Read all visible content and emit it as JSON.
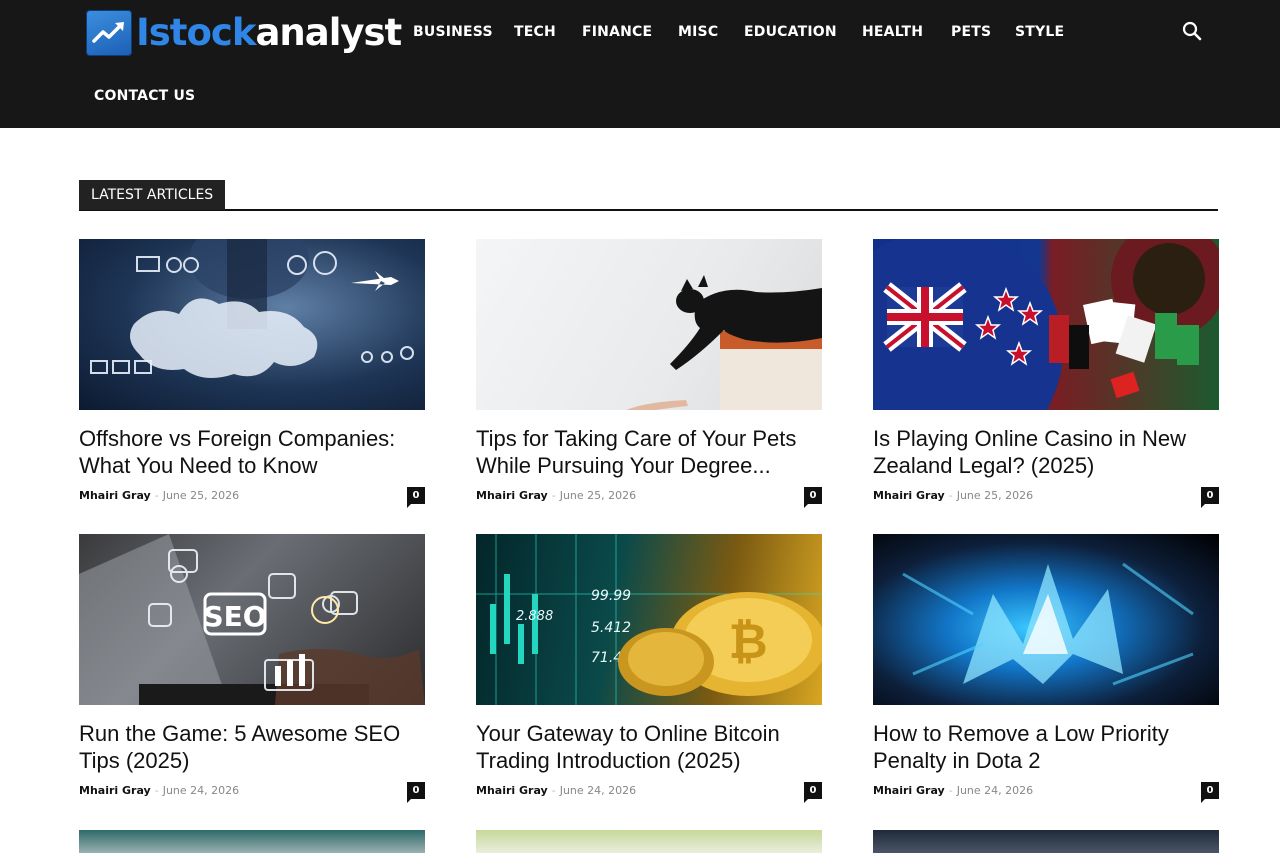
{
  "header": {
    "logo": {
      "part1": "Istock",
      "part2": "analyst"
    },
    "nav": [
      {
        "label": "BUSINESS"
      },
      {
        "label": "TECH"
      },
      {
        "label": "FINANCE"
      },
      {
        "label": "MISC"
      },
      {
        "label": "EDUCATION"
      },
      {
        "label": "HEALTH"
      },
      {
        "label": "PETS"
      },
      {
        "label": "STYLE"
      },
      {
        "label": "CONTACT US"
      }
    ],
    "search_icon": "search-icon"
  },
  "section": {
    "title": "LATEST ARTICLES"
  },
  "articles": [
    {
      "title": "Offshore vs Foreign Companies: What You Need to Know",
      "author": "Mhairi Gray",
      "date": "June 25, 2026",
      "comments": "0"
    },
    {
      "title": "Tips for Taking Care of Your Pets While Pursuing Your Degree...",
      "author": "Mhairi Gray",
      "date": "June 25, 2026",
      "comments": "0"
    },
    {
      "title": "Is Playing Online Casino in New Zealand Legal? (2025)",
      "author": "Mhairi Gray",
      "date": "June 25, 2026",
      "comments": "0"
    },
    {
      "title": "Run the Game: 5 Awesome SEO Tips (2025)",
      "author": "Mhairi Gray",
      "date": "June 24, 2026",
      "comments": "0"
    },
    {
      "title": "Your Gateway to Online Bitcoin Trading Introduction (2025)",
      "author": "Mhairi Gray",
      "date": "June 24, 2026",
      "comments": "0"
    },
    {
      "title": "How to Remove a Low Priority Penalty in Dota 2",
      "author": "Mhairi Gray",
      "date": "June 24, 2026",
      "comments": "0"
    }
  ],
  "thumbnail_art": {
    "seo": "SEO",
    "bitcoin_numbers": [
      "99.99",
      "5.412",
      "71.45",
      "2.888"
    ]
  },
  "colors": {
    "header_bg": "#171717",
    "accent_blue": "#2f86e6",
    "section_tag_bg": "#222222"
  }
}
